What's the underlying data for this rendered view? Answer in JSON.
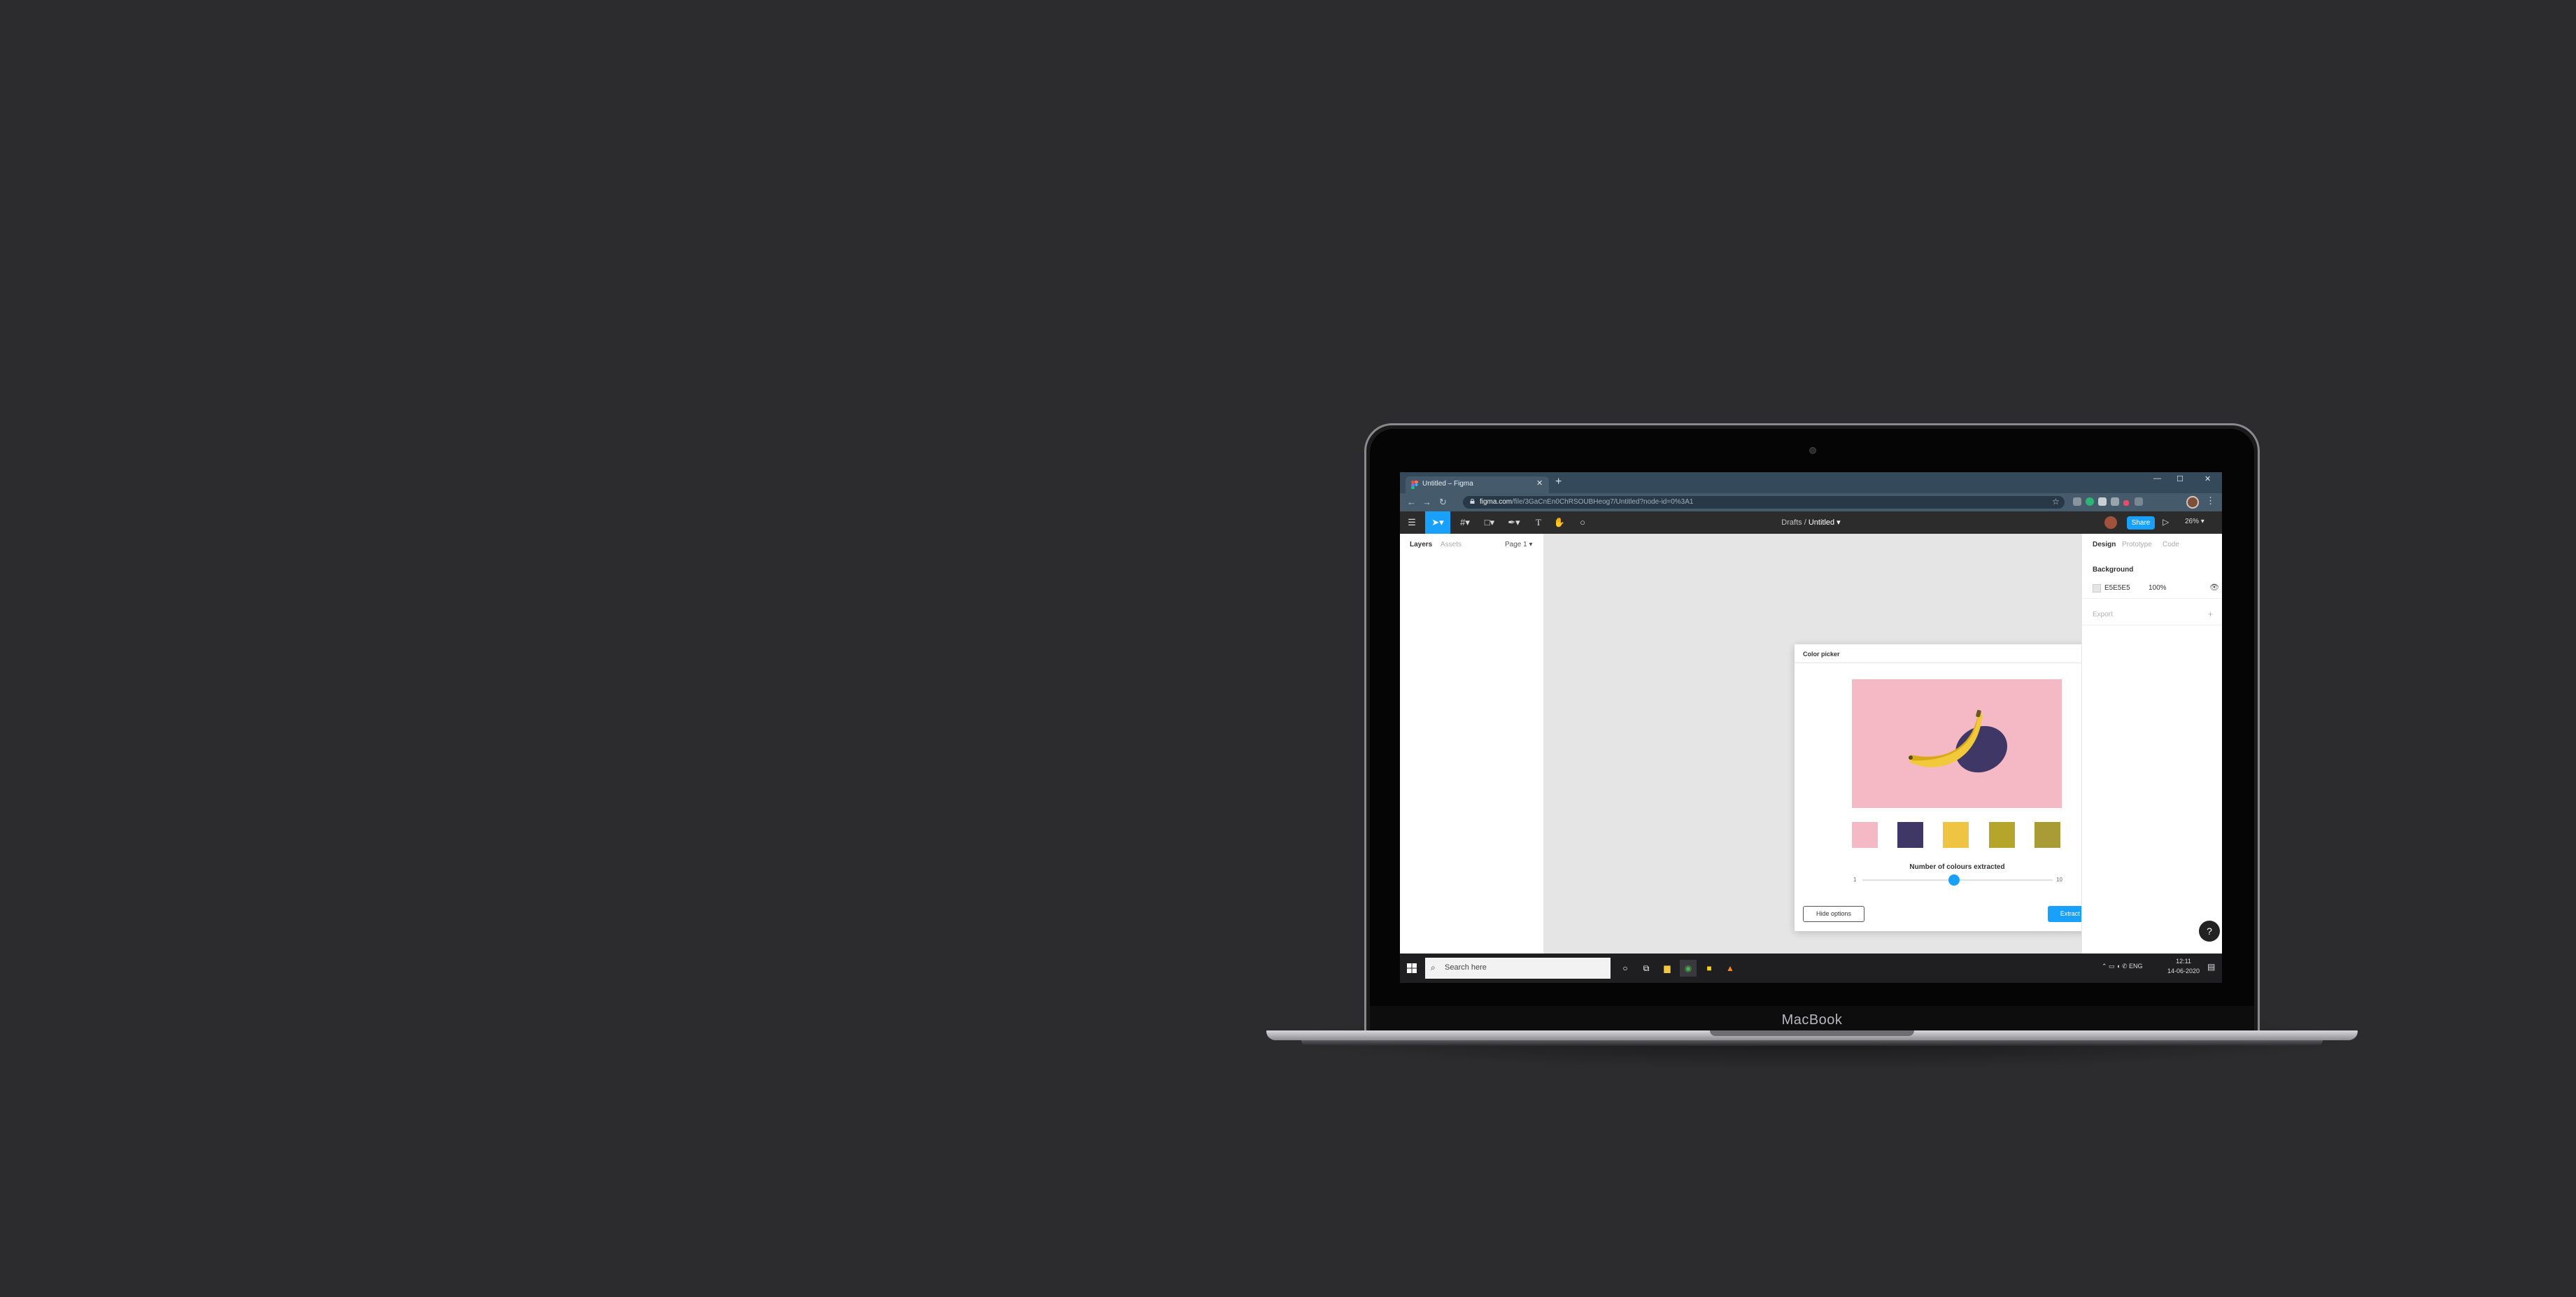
{
  "browser": {
    "tab_title": "Untitled – Figma",
    "new_tab_glyph": "+",
    "url_host": "figma.com",
    "url_path": "/file/3GaCnEn0ChRSOUBHeog7/Untitled?node-id=0%3A1",
    "window_controls": [
      "—",
      "☐",
      "✕"
    ]
  },
  "figma": {
    "breadcrumb_project": "Drafts",
    "breadcrumb_sep": "/",
    "file_name": "Untitled",
    "share_label": "Share",
    "zoom": "26%",
    "left_tabs": [
      "Layers",
      "Assets"
    ],
    "page_selector": "Page 1",
    "right_tabs": [
      "Design",
      "Prototype",
      "Code"
    ],
    "background": {
      "heading": "Background",
      "hex": "E5E5E5",
      "opacity": "100%"
    },
    "export_label": "Export",
    "help": "?"
  },
  "plugin": {
    "title": "Color picker",
    "extracted_colors": [
      "#f4b9c5",
      "#3f3766",
      "#efc442",
      "#b5a52a",
      "#a99c37"
    ],
    "slider_label": "Number of colours extracted",
    "slider_min": "1",
    "slider_max": "10",
    "slider_value_fraction": 0.48,
    "hide_options_label": "Hide options",
    "extract_label": "Extract colors"
  },
  "taskbar": {
    "search_placeholder": "Search here",
    "language": "ENG",
    "time": "12:11",
    "date": "14-06-2020"
  },
  "device": {
    "brand": "MacBook"
  },
  "colors": {
    "background": "#2c2c2e",
    "accent": "#18a0fb",
    "browser_tabbar": "#34495a"
  }
}
